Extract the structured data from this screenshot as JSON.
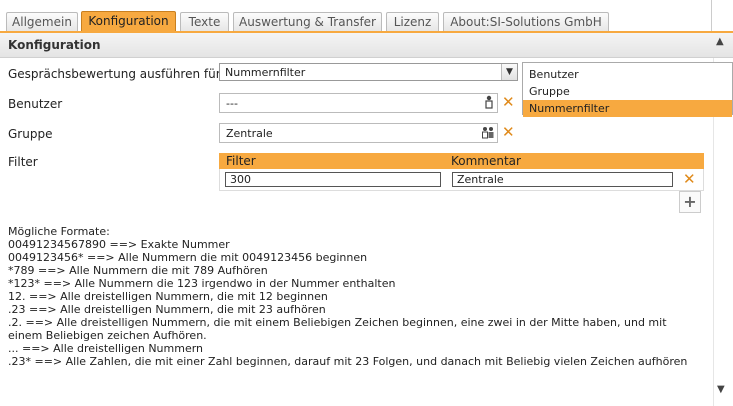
{
  "tabs": [
    {
      "label": "Allgemein",
      "active": false
    },
    {
      "label": "Konfiguration",
      "active": true
    },
    {
      "label": "Texte",
      "active": false
    },
    {
      "label": "Auswertung & Transfer",
      "active": false
    },
    {
      "label": "Lizenz",
      "active": false
    },
    {
      "label": "About:SI-Solutions GmbH",
      "active": false
    }
  ],
  "section": {
    "title": "Konfiguration"
  },
  "form": {
    "evaluation": {
      "label": "Gesprächsbewertung ausführen für",
      "value": "Nummernfilter"
    },
    "dropdown_options": [
      "Benutzer",
      "Gruppe",
      "Nummernfilter"
    ],
    "dropdown_selected": "Nummernfilter",
    "user": {
      "label": "Benutzer",
      "value": "---"
    },
    "group": {
      "label": "Gruppe",
      "value": "Zentrale"
    },
    "filter": {
      "label": "Filter",
      "columns": [
        "Filter",
        "Kommentar"
      ],
      "rows": [
        {
          "filter": "300",
          "comment": "Zentrale"
        }
      ]
    }
  },
  "formats": {
    "heading": "Mögliche Formate:",
    "lines": [
      "00491234567890 ==> Exakte Nummer",
      "0049123456* ==> Alle Nummern die mit 0049123456 beginnen",
      "*789 ==> Alle Nummern die mit 789 Aufhören",
      "*123* ==> Alle Nummern die 123 irgendwo in der Nummer enthalten",
      "12. ==> Alle dreistelligen Nummern, die mit 12 beginnen",
      ".23 ==> Alle dreistelligen Nummern, die mit 23 aufhören",
      ".2. ==> Alle dreistelligen Nummern, die mit einem Beliebigen Zeichen beginnen, eine zwei in der Mitte haben, und mit einem Beliebigen zeichen Aufhören.",
      "... ==> Alle dreistelligen Nummern",
      ".23* ==> Alle Zahlen, die mit einer Zahl beginnen, darauf mit 23 Folgen, und danach mit Beliebig vielen Zeichen aufhören"
    ]
  },
  "colors": {
    "accent": "#f7a940",
    "delete": "#e08a1a"
  },
  "icons": {
    "delete": "close-icon",
    "add": "plus-icon",
    "user": "user-icon",
    "group": "group-icon"
  }
}
